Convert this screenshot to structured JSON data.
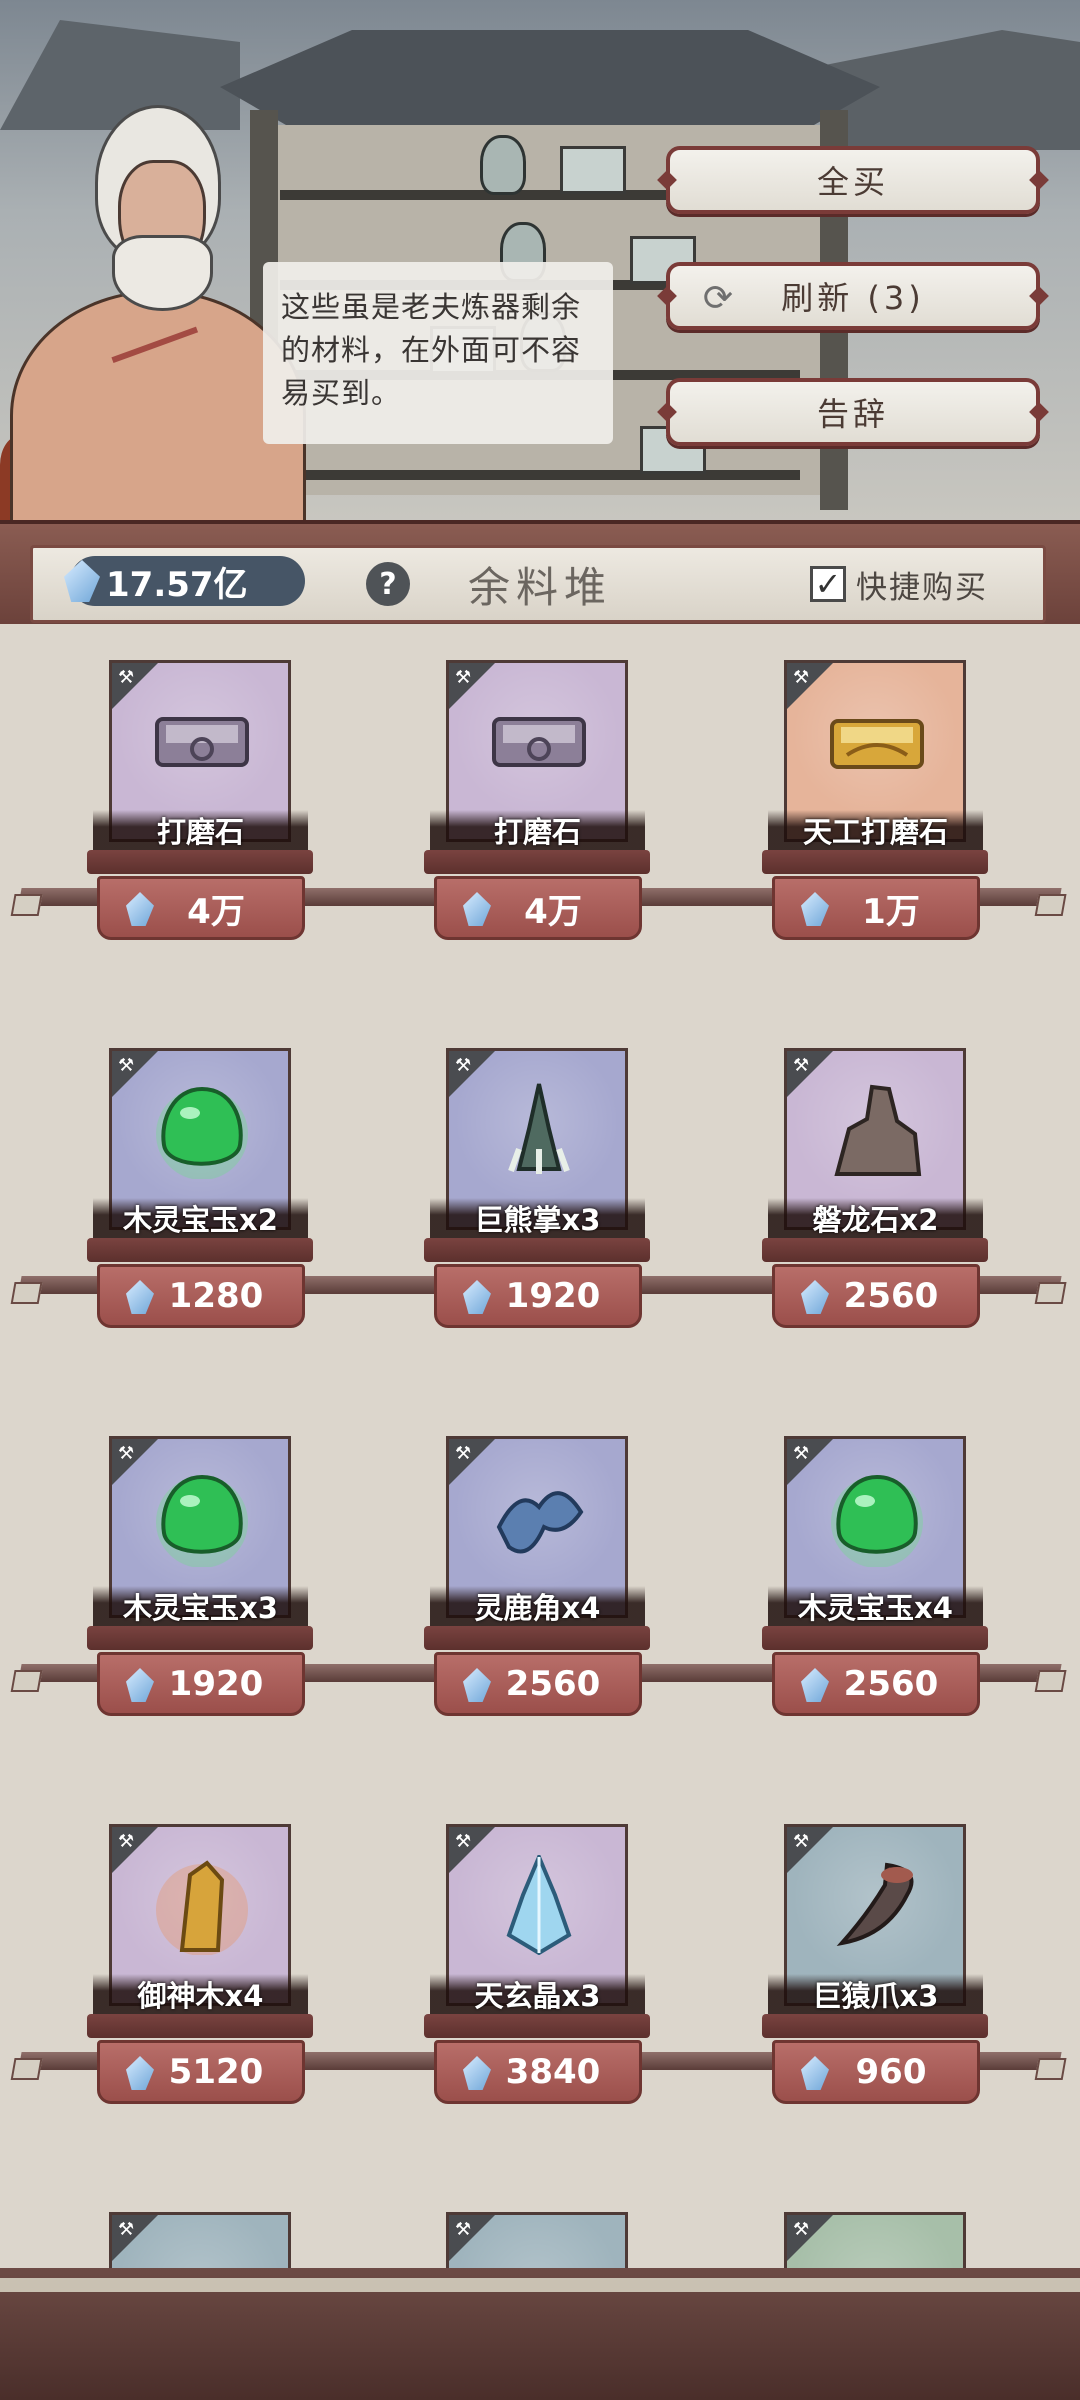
{
  "dialog": {
    "text": "这些虽是老夫炼器剩余的材料，在外面可不容易买到。"
  },
  "menu": {
    "buy_all": "全买",
    "refresh": "刷新 (3)",
    "leave": "告辞"
  },
  "header": {
    "currency": "17.57亿",
    "help": "?",
    "title": "余料堆",
    "quick_buy": "快捷购买",
    "quick_buy_checked": true
  },
  "items": [
    {
      "name": "打磨石",
      "price": "4万",
      "bg": "#c9b7d4",
      "art": "whetstone"
    },
    {
      "name": "打磨石",
      "price": "4万",
      "bg": "#c9b7d4",
      "art": "whetstone"
    },
    {
      "name": "天工打磨石",
      "price": "1万",
      "bg": "#e6b49a",
      "art": "gold-whetstone"
    },
    {
      "name": "木灵宝玉x2",
      "price": "1280",
      "bg": "#a6a8cf",
      "art": "green-jade"
    },
    {
      "name": "巨熊掌x3",
      "price": "1920",
      "bg": "#a6a8cf",
      "art": "bear-paw"
    },
    {
      "name": "磐龙石x2",
      "price": "2560",
      "bg": "#c9b7d4",
      "art": "dragon-rock"
    },
    {
      "name": "木灵宝玉x3",
      "price": "1920",
      "bg": "#a6a8cf",
      "art": "green-jade"
    },
    {
      "name": "灵鹿角x4",
      "price": "2560",
      "bg": "#a6a8cf",
      "art": "deer-antler"
    },
    {
      "name": "木灵宝玉x4",
      "price": "2560",
      "bg": "#a6a8cf",
      "art": "green-jade"
    },
    {
      "name": "御神木x4",
      "price": "5120",
      "bg": "#c9b7d4",
      "art": "divine-wood"
    },
    {
      "name": "天玄晶x3",
      "price": "3840",
      "bg": "#c9b7d4",
      "art": "crystal"
    },
    {
      "name": "巨猿爪x3",
      "price": "960",
      "bg": "#9fb4bd",
      "art": "ape-claw"
    },
    {
      "name": "",
      "price": "",
      "bg": "#9fb4bd",
      "art": "partial"
    },
    {
      "name": "",
      "price": "",
      "bg": "#9fb4bd",
      "art": "partial"
    },
    {
      "name": "",
      "price": "",
      "bg": "#a7bfa9",
      "art": "partial"
    }
  ],
  "colors": {
    "accent": "#9b4f4b",
    "frame": "#6e3531"
  }
}
